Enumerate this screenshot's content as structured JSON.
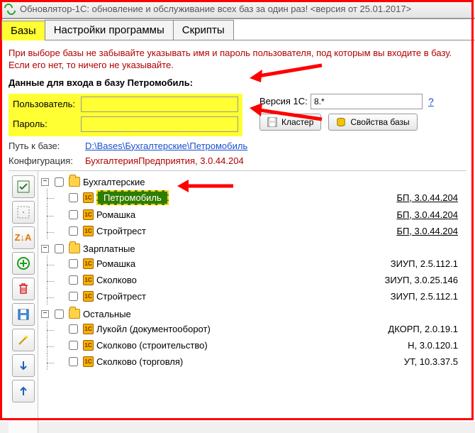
{
  "window": {
    "title": "Обновлятор-1С: обновление и обслуживание всех баз за один раз! <версия от 25.01.2017>"
  },
  "tabs": [
    {
      "label": "Базы",
      "active": true
    },
    {
      "label": "Настройки программы",
      "active": false
    },
    {
      "label": "Скрипты",
      "active": false
    }
  ],
  "hint": "При выборе базы не забывайте указывать имя и пароль пользователя, под которым вы входите в базу. Если его нет, то ничего не указывайте.",
  "section_title": "Данные для входа в базу Петромобиль:",
  "fields": {
    "user_label": "Пользователь:",
    "user_value": "",
    "password_label": "Пароль:",
    "password_value": ""
  },
  "version": {
    "label": "Версия 1С:",
    "value": "8.*",
    "help": "?"
  },
  "buttons": {
    "cluster": "Кластер",
    "props": "Свойства базы"
  },
  "info": {
    "path_label": "Путь к базе:",
    "path_value": "D:\\Bases\\Бухгалтерские\\Петромобиль",
    "config_label": "Конфигурация:",
    "config_value": "БухгалтерияПредприятия, 3.0.44.204"
  },
  "toolbar_icons": [
    "check-icon",
    "dots-icon",
    "sort-icon",
    "add-icon",
    "delete-icon",
    "save-icon",
    "wand-icon",
    "movedown-icon",
    "moveup-icon"
  ],
  "tree": [
    {
      "label": "Бухгалтерские",
      "expanded": true,
      "children": [
        {
          "label": "Петромобиль",
          "version": "БП, 3.0.44.204",
          "selected": true
        },
        {
          "label": "Ромашка",
          "version": "БП, 3.0.44.204"
        },
        {
          "label": "Стройтрест",
          "version": "БП, 3.0.44.204"
        }
      ]
    },
    {
      "label": "Зарплатные",
      "expanded": true,
      "children": [
        {
          "label": "Ромашка",
          "version": "ЗИУП, 2.5.112.1"
        },
        {
          "label": "Сколково",
          "version": "ЗИУП, 3.0.25.146"
        },
        {
          "label": "Стройтрест",
          "version": "ЗИУП, 2.5.112.1"
        }
      ]
    },
    {
      "label": "Остальные",
      "expanded": true,
      "children": [
        {
          "label": "Лукойл (документооборот)",
          "version": "ДКОРП, 2.0.19.1"
        },
        {
          "label": "Сколково (строительство)",
          "version": "Н, 3.0.120.1"
        },
        {
          "label": "Сколково (торговля)",
          "version": "УТ, 10.3.37.5"
        }
      ]
    }
  ],
  "sort_text": "Z↓A"
}
